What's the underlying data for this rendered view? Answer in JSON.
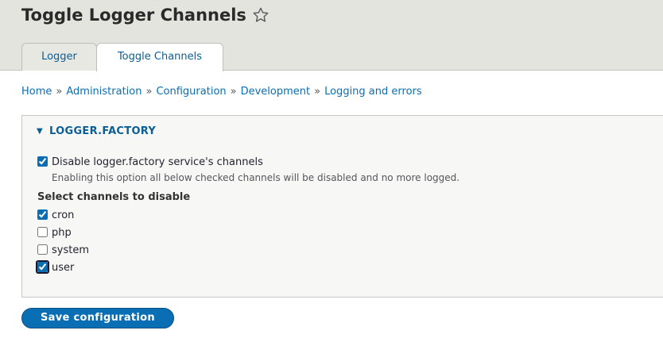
{
  "page": {
    "title": "Toggle Logger Channels",
    "favorite_icon": "star-outline-icon"
  },
  "tabs": [
    {
      "label": "Logger",
      "active": false
    },
    {
      "label": "Toggle Channels",
      "active": true
    }
  ],
  "breadcrumb": {
    "separator": "»",
    "items": [
      "Home",
      "Administration",
      "Configuration",
      "Development",
      "Logging and errors"
    ]
  },
  "panel": {
    "summary": "LOGGER.FACTORY",
    "expanded": true,
    "disable_all": {
      "label": "Disable logger.factory service's channels",
      "description": "Enabling this option all below checked channels will be disabled and no more logged.",
      "checked": true
    },
    "channels_title": "Select channels to disable",
    "channels": [
      {
        "label": "cron",
        "checked": true
      },
      {
        "label": "php",
        "checked": false
      },
      {
        "label": "system",
        "checked": false
      },
      {
        "label": "user",
        "checked": true,
        "focused": true
      }
    ]
  },
  "actions": {
    "save_label": "Save configuration"
  },
  "colors": {
    "header_bg": "#e4e4de",
    "link": "#0a6eb4",
    "primary_button": "#0a6eb4"
  }
}
